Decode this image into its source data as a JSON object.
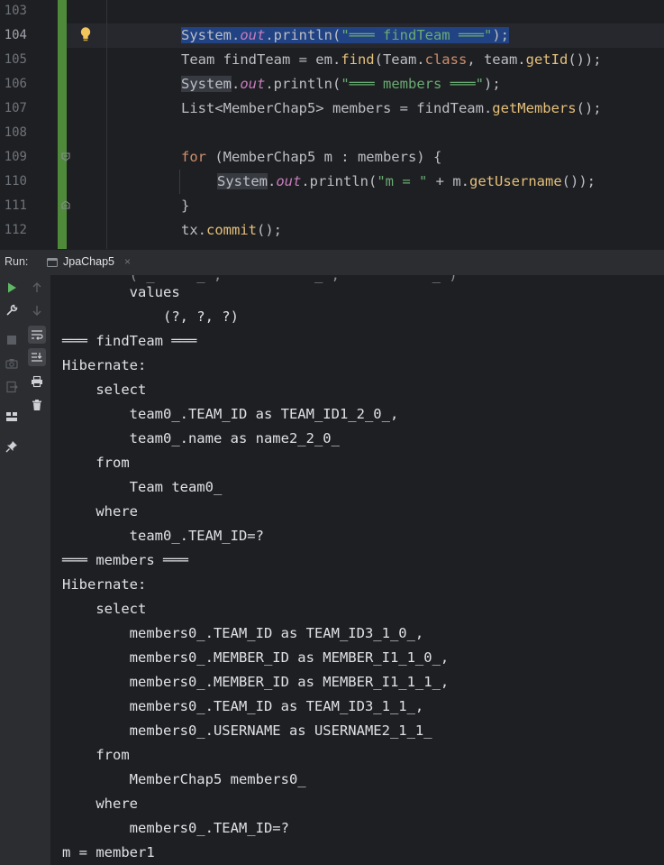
{
  "editor": {
    "line_numbers": [
      "103",
      "104",
      "105",
      "106",
      "107",
      "108",
      "109",
      "110",
      "111",
      "112"
    ],
    "lines": {
      "l104": {
        "a": "System.",
        "b": "out",
        "c": ".println(",
        "d": "\"═══ findTeam ═══\"",
        "e": ");"
      },
      "l105": {
        "a": "Team findTeam = em.",
        "b": "find",
        "c": "(Team.",
        "d": "class",
        "e": ", team.",
        "f": "getId",
        "g": "());"
      },
      "l106": {
        "a": "System",
        "b": ".",
        "c": "out",
        "d": ".println(",
        "e": "\"═══ members ═══\"",
        "f": ");"
      },
      "l107": {
        "a": "List<MemberChap5> members = findTeam.",
        "b": "getMembers",
        "c": "();"
      },
      "l109": {
        "a": "for",
        "b": " (MemberChap5 m : members) {"
      },
      "l110": {
        "a": "System",
        "b": ".",
        "c": "out",
        "d": ".println(",
        "e": "\"m = \"",
        "f": " + m.",
        "g": "getUsername",
        "h": "());"
      },
      "l111": {
        "a": "}"
      },
      "l112": {
        "a": "tx.",
        "b": "commit",
        "c": "();"
      }
    }
  },
  "run_panel": {
    "label": "Run:",
    "tab_label": "JpaChap5",
    "tab_close": "×"
  },
  "console": {
    "lines": [
      "        values",
      "            (?, ?, ?)",
      "═══ findTeam ═══",
      "Hibernate:",
      "    select",
      "        team0_.TEAM_ID as TEAM_ID1_2_0_,",
      "        team0_.name as name2_2_0_",
      "    from",
      "        Team team0_",
      "    where",
      "        team0_.TEAM_ID=?",
      "═══ members ═══",
      "Hibernate:",
      "    select",
      "        members0_.TEAM_ID as TEAM_ID3_1_0_,",
      "        members0_.MEMBER_ID as MEMBER_I1_1_0_,",
      "        members0_.MEMBER_ID as MEMBER_I1_1_1_,",
      "        members0_.TEAM_ID as TEAM_ID3_1_1_,",
      "        members0_.USERNAME as USERNAME2_1_1_",
      "    from",
      "        MemberChap5 members0_",
      "    where",
      "        members0_.TEAM_ID=?",
      "m = member1"
    ]
  },
  "colors": {
    "accent": "#3574f0",
    "vcs_added": "#4f8a3b",
    "run_green": "#5fb865"
  }
}
